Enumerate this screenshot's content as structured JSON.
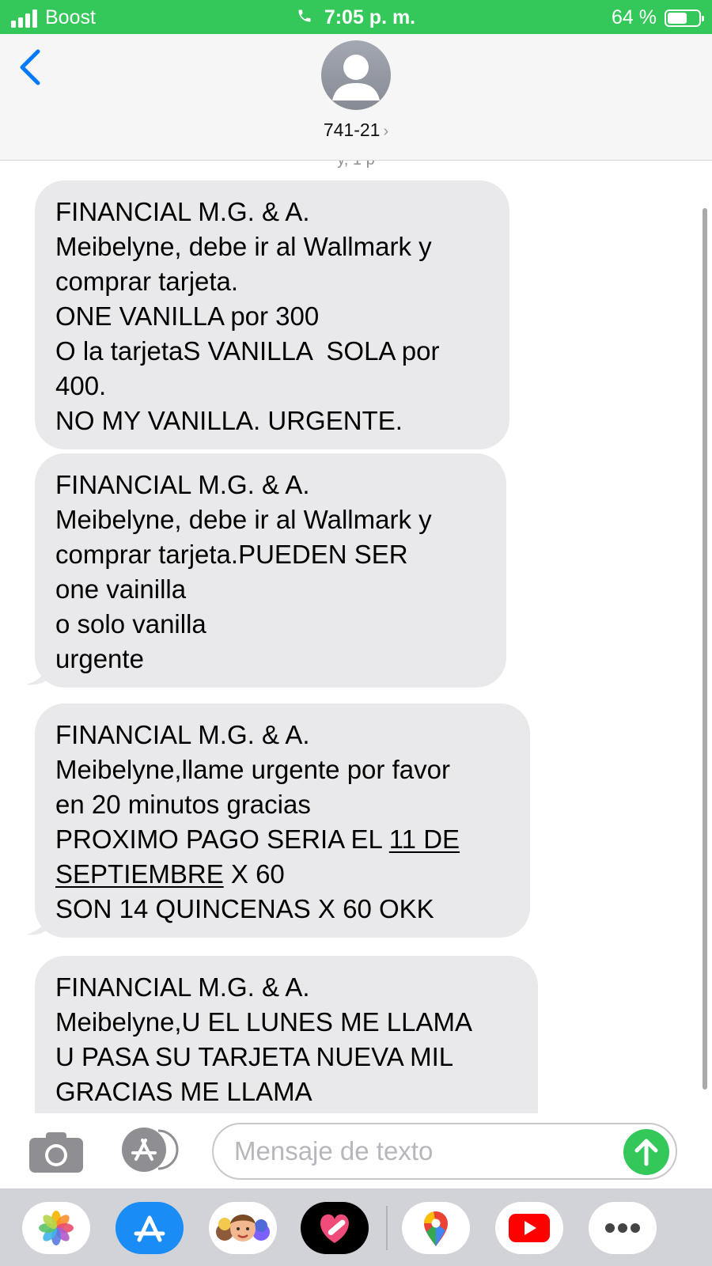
{
  "status_bar": {
    "carrier": "Boost",
    "time": "7:05 p. m.",
    "battery": "64 %",
    "battery_level": 0.64
  },
  "header": {
    "contact": "741-21",
    "chevron": "›"
  },
  "messages": {
    "clipped_label": "y, 1 p",
    "bubbles": [
      {
        "lines": [
          "FINANCIAL M.G. & A.",
          "Meibelyne, debe ir al Wallmark y",
          "comprar tarjeta.",
          "ONE VANILLA por 300",
          "O la tarjetaS VANILLA  SOLA por",
          "400.",
          "NO MY VANILLA. URGENTE."
        ]
      },
      {
        "lines": [
          "FINANCIAL M.G. & A.",
          "Meibelyne, debe ir al Wallmark y",
          "comprar tarjeta.PUEDEN SER",
          "one vainilla",
          "o solo vanilla",
          "urgente"
        ]
      },
      {
        "lines": [
          "FINANCIAL M.G. & A.",
          "Meibelyne,llame urgente por favor",
          "en 20 minutos gracias"
        ],
        "line4_prefix": "PROXIMO PAGO SERIA EL ",
        "line4_link": "11 DE",
        "line5_link": "SEPTIEMBRE",
        "line5_suffix": " X 60",
        "line6": "SON 14 QUINCENAS X 60 OKK"
      },
      {
        "lines": [
          "FINANCIAL M.G. & A.",
          "Meibelyne,U EL LUNES ME LLAMA",
          "U PASA SU TARJETA NUEVA MIL",
          "GRACIAS ME LLAMA"
        ]
      }
    ]
  },
  "compose": {
    "placeholder": "Mensaje de texto"
  },
  "icons": {
    "status": [
      "signal-icon",
      "phone-icon",
      "battery-icon"
    ],
    "header": [
      "back-chevron-icon",
      "contact-avatar-icon"
    ],
    "compose": [
      "camera-icon",
      "app-store-icon",
      "send-arrow-icon"
    ],
    "drawer": [
      "photos-icon",
      "app-store-icon",
      "memoji-icon",
      "digital-touch-icon",
      "google-maps-icon",
      "youtube-icon",
      "more-icon"
    ]
  },
  "colors": {
    "status_green": "#34c759",
    "bubble_gray": "#e9e9eb",
    "ios_blue": "#007aff",
    "send_green": "#34c759"
  }
}
